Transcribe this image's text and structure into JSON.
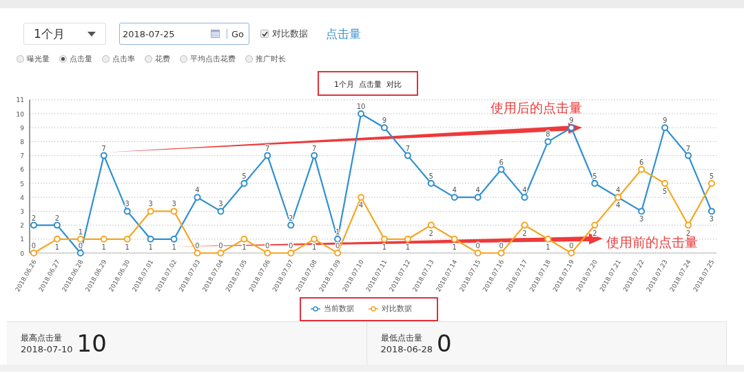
{
  "period_select": {
    "value": "1个月"
  },
  "date_field": {
    "value": "2018-07-25"
  },
  "go_button": "Go",
  "compare_checkbox": {
    "label": "对比数据",
    "checked": true
  },
  "metric_title": "点击量",
  "metrics": [
    {
      "label": "曝光量",
      "selected": false
    },
    {
      "label": "点击量",
      "selected": true
    },
    {
      "label": "点击率",
      "selected": false
    },
    {
      "label": "花费",
      "selected": false
    },
    {
      "label": "平均点击花费",
      "selected": false
    },
    {
      "label": "推广时长",
      "selected": false
    }
  ],
  "chart": {
    "title_parts": [
      "1个月",
      "点击量",
      "对比"
    ],
    "title_highlighted": true,
    "legend_highlighted": true,
    "chart_data": {
      "type": "line",
      "categories": [
        "2018.06.26",
        "2018.06.27",
        "2018.06.28",
        "2018.06.29",
        "2018.06.30",
        "2018.07.01",
        "2018.07.02",
        "2018.07.03",
        "2018.07.04",
        "2018.07.05",
        "2018.07.06",
        "2018.07.07",
        "2018.07.08",
        "2018.07.09",
        "2018.07.10",
        "2018.07.11",
        "2018.07.12",
        "2018.07.13",
        "2018.07.14",
        "2018.07.15",
        "2018.07.16",
        "2018.07.17",
        "2018.07.18",
        "2018.07.19",
        "2018.07.20",
        "2018.07.21",
        "2018.07.22",
        "2018.07.23",
        "2018.07.24",
        "2018.07.25"
      ],
      "series": [
        {
          "name": "当前数据",
          "color": "#2e8fd0",
          "marker": "circle",
          "values": [
            2,
            2,
            0,
            7,
            3,
            1,
            1,
            4,
            3,
            5,
            7,
            2,
            7,
            1,
            10,
            9,
            7,
            5,
            4,
            4,
            6,
            4,
            8,
            9,
            5,
            4,
            3,
            9,
            7,
            3
          ]
        },
        {
          "name": "对比数据",
          "color": "#f5a623",
          "marker": "circle",
          "values": [
            0,
            1,
            1,
            1,
            1,
            3,
            3,
            0,
            0,
            1,
            0,
            0,
            1,
            0,
            4,
            1,
            1,
            2,
            1,
            0,
            0,
            2,
            1,
            0,
            2,
            4,
            6,
            5,
            2,
            5
          ]
        }
      ],
      "grid": true,
      "ylim": [
        0,
        11
      ],
      "yticks": [
        0,
        1,
        2,
        3,
        4,
        5,
        6,
        7,
        8,
        9,
        10,
        11
      ],
      "data_labels": true,
      "annotations": [
        {
          "text": "使用后的点击量"
        },
        {
          "text": "使用前的点击量"
        }
      ]
    }
  },
  "stats": [
    {
      "label": "最高点击量",
      "date": "2018-07-10",
      "value": "10"
    },
    {
      "label": "最低点击量",
      "date": "2018-06-28",
      "value": "0"
    }
  ]
}
